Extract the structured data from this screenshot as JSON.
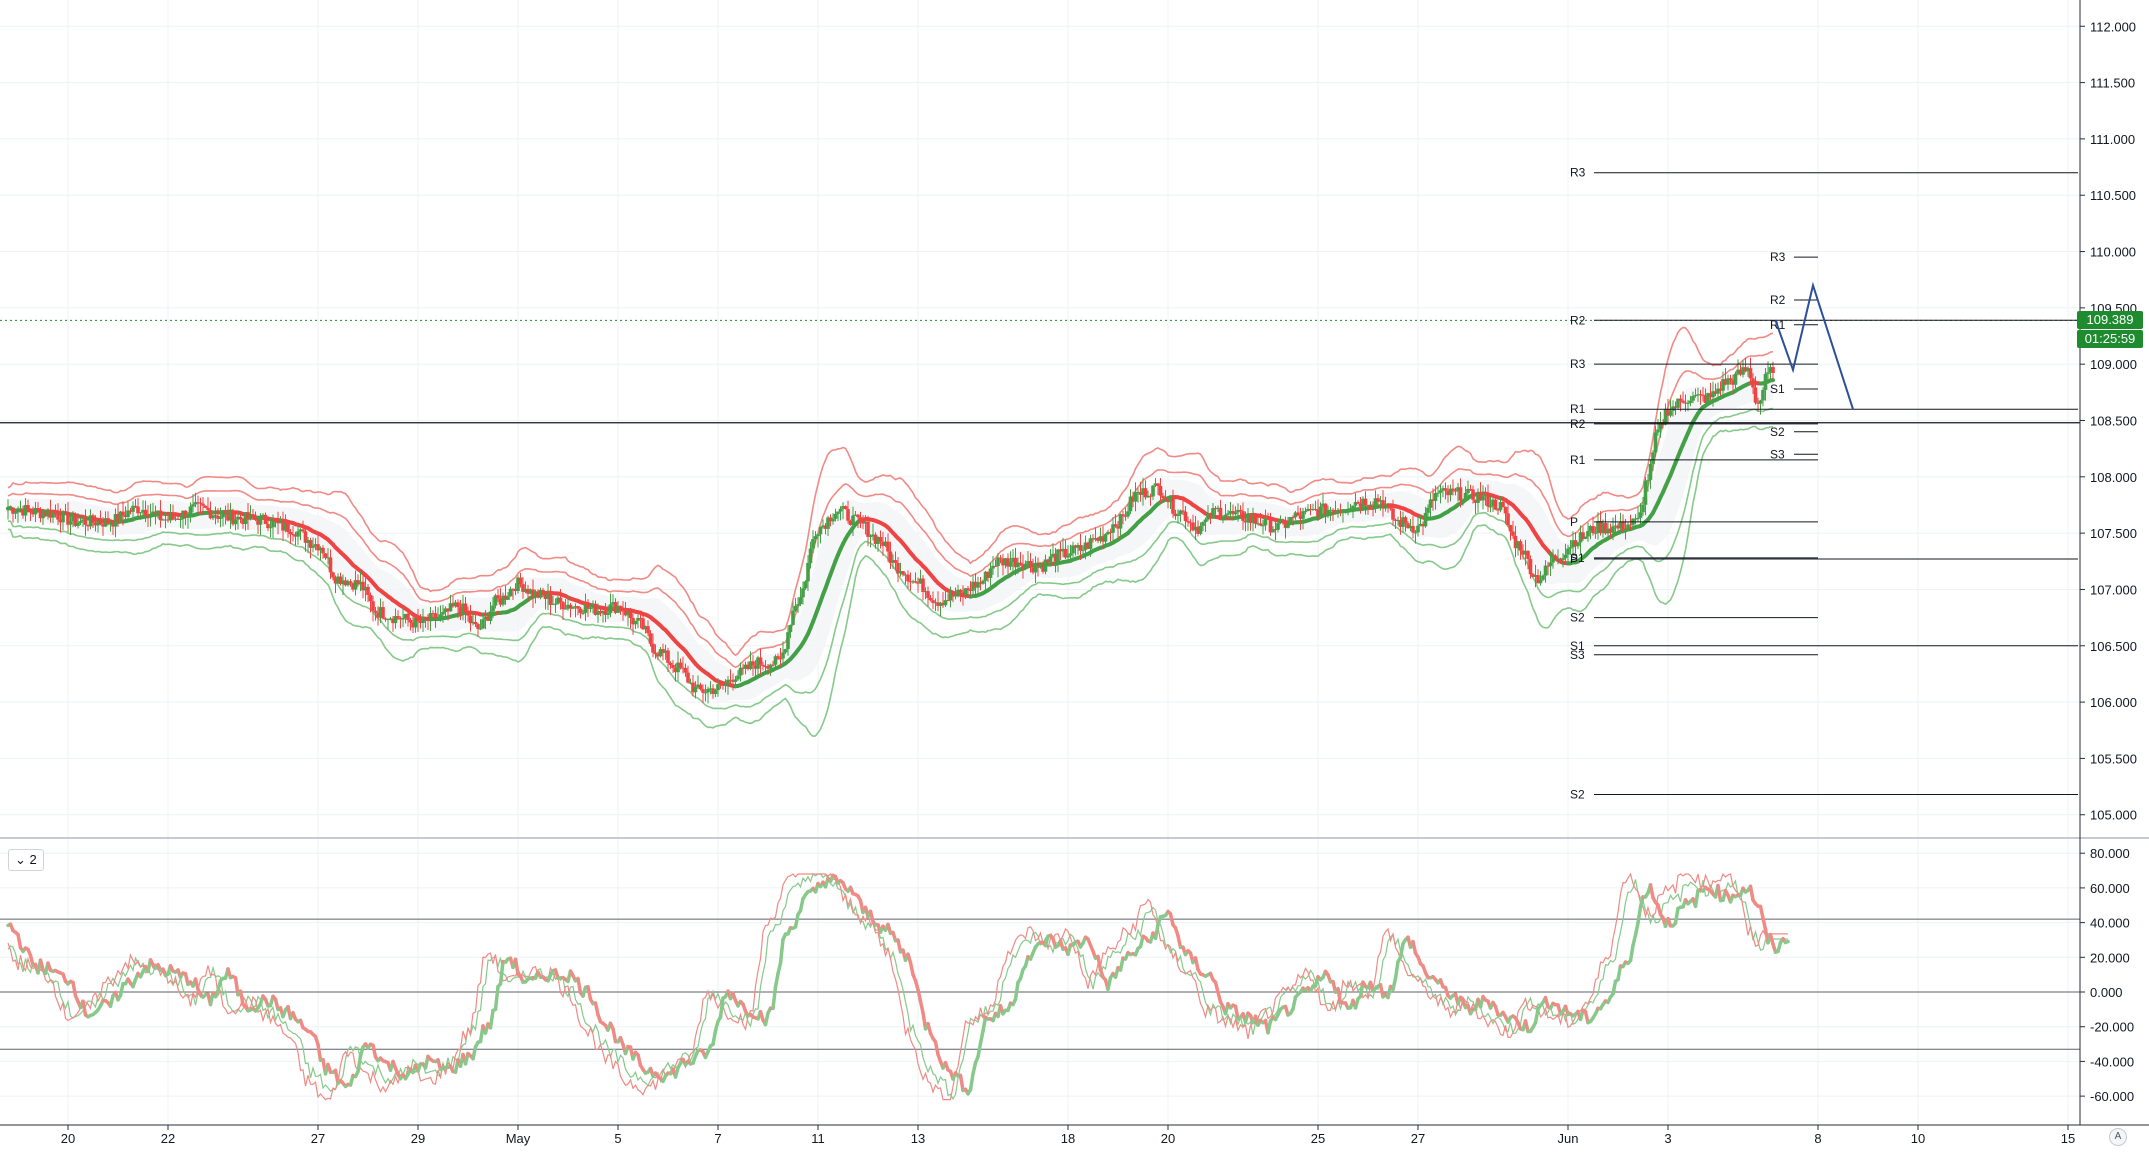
{
  "chart_data": [
    {
      "type": "candlestick",
      "pane": "price",
      "ylim": [
        104.9,
        112.1
      ],
      "yticks": [
        "112.000",
        "111.500",
        "111.000",
        "110.500",
        "110.000",
        "109.500",
        "109.000",
        "108.500",
        "108.000",
        "107.500",
        "107.000",
        "106.500",
        "106.000",
        "105.500",
        "105.000"
      ],
      "x_labels": [
        {
          "label": "20",
          "x": 12
        },
        {
          "label": "22",
          "x": 32
        },
        {
          "label": "27",
          "x": 62
        },
        {
          "label": "29",
          "x": 82
        },
        {
          "label": "May",
          "x": 102
        },
        {
          "label": "5",
          "x": 122
        },
        {
          "label": "7",
          "x": 142
        },
        {
          "label": "11",
          "x": 162
        },
        {
          "label": "13",
          "x": 182
        },
        {
          "label": "18",
          "x": 212
        },
        {
          "label": "20",
          "x": 232
        },
        {
          "label": "25",
          "x": 262
        },
        {
          "label": "27",
          "x": 282
        },
        {
          "label": "Jun",
          "x": 312
        },
        {
          "label": "3",
          "x": 332
        },
        {
          "label": "8",
          "x": 362
        },
        {
          "label": "10",
          "x": 382
        },
        {
          "label": "15",
          "x": 412
        }
      ],
      "x_last_candle": 353,
      "x_right_edge": 414,
      "anchors": [
        [
          0,
          107.72
        ],
        [
          8,
          107.68
        ],
        [
          14,
          107.6
        ],
        [
          20,
          107.6
        ],
        [
          26,
          107.72
        ],
        [
          32,
          107.62
        ],
        [
          38,
          107.72
        ],
        [
          44,
          107.64
        ],
        [
          50,
          107.62
        ],
        [
          56,
          107.55
        ],
        [
          62,
          107.4
        ],
        [
          66,
          107.1
        ],
        [
          70,
          107.05
        ],
        [
          74,
          106.8
        ],
        [
          78,
          106.75
        ],
        [
          82,
          106.7
        ],
        [
          86,
          106.75
        ],
        [
          90,
          106.85
        ],
        [
          94,
          106.65
        ],
        [
          98,
          106.9
        ],
        [
          102,
          107.05
        ],
        [
          106,
          106.95
        ],
        [
          110,
          106.88
        ],
        [
          114,
          106.85
        ],
        [
          118,
          106.82
        ],
        [
          122,
          106.85
        ],
        [
          126,
          106.7
        ],
        [
          130,
          106.45
        ],
        [
          134,
          106.3
        ],
        [
          138,
          106.1
        ],
        [
          142,
          106.12
        ],
        [
          146,
          106.25
        ],
        [
          150,
          106.35
        ],
        [
          154,
          106.35
        ],
        [
          158,
          106.9
        ],
        [
          162,
          107.55
        ],
        [
          166,
          107.7
        ],
        [
          170,
          107.6
        ],
        [
          174,
          107.45
        ],
        [
          178,
          107.2
        ],
        [
          182,
          107.05
        ],
        [
          186,
          106.9
        ],
        [
          190,
          106.95
        ],
        [
          194,
          107.05
        ],
        [
          198,
          107.25
        ],
        [
          202,
          107.25
        ],
        [
          206,
          107.2
        ],
        [
          210,
          107.3
        ],
        [
          214,
          107.35
        ],
        [
          218,
          107.45
        ],
        [
          222,
          107.6
        ],
        [
          226,
          107.85
        ],
        [
          230,
          107.9
        ],
        [
          234,
          107.7
        ],
        [
          238,
          107.55
        ],
        [
          242,
          107.7
        ],
        [
          246,
          107.65
        ],
        [
          250,
          107.6
        ],
        [
          254,
          107.55
        ],
        [
          258,
          107.65
        ],
        [
          262,
          107.7
        ],
        [
          266,
          107.72
        ],
        [
          270,
          107.78
        ],
        [
          274,
          107.8
        ],
        [
          278,
          107.6
        ],
        [
          282,
          107.55
        ],
        [
          286,
          107.85
        ],
        [
          290,
          107.85
        ],
        [
          294,
          107.82
        ],
        [
          298,
          107.75
        ],
        [
          302,
          107.4
        ],
        [
          306,
          107.1
        ],
        [
          310,
          107.3
        ],
        [
          314,
          107.45
        ],
        [
          318,
          107.55
        ],
        [
          322,
          107.55
        ],
        [
          326,
          107.6
        ],
        [
          328,
          108.0
        ],
        [
          330,
          108.4
        ],
        [
          332,
          108.6
        ],
        [
          336,
          108.7
        ],
        [
          340,
          108.7
        ],
        [
          344,
          108.85
        ],
        [
          348,
          108.95
        ],
        [
          350,
          108.65
        ],
        [
          352,
          108.9
        ],
        [
          355,
          109.2
        ],
        [
          356,
          109.39
        ]
      ],
      "series_names": [],
      "pivots": [
        {
          "label": "R3",
          "price": 110.7,
          "x_from": 312,
          "x_to": 414
        },
        {
          "label": "R2",
          "price": 109.39,
          "x_from": 312,
          "x_to": 414
        },
        {
          "label": "R3",
          "price": 109.0,
          "x_from": 312,
          "x_to": 362
        },
        {
          "label": "R1",
          "price": 108.6,
          "x_from": 312,
          "x_to": 414
        },
        {
          "label": "R2",
          "price": 108.47,
          "x_from": 312,
          "x_to": 362
        },
        {
          "label": "R1",
          "price": 108.15,
          "x_from": 312,
          "x_to": 362
        },
        {
          "label": "P",
          "price": 107.6,
          "x_from": 312,
          "x_to": 362
        },
        {
          "label": "P",
          "price": 107.27,
          "x_from": 312,
          "x_to": 414
        },
        {
          "label": "S1",
          "price": 107.28,
          "x_from": 312,
          "x_to": 362
        },
        {
          "label": "S2",
          "price": 106.75,
          "x_from": 312,
          "x_to": 362
        },
        {
          "label": "S1",
          "price": 106.5,
          "x_from": 312,
          "x_to": 414
        },
        {
          "label": "S3",
          "price": 106.42,
          "x_from": 312,
          "x_to": 362
        },
        {
          "label": "S2",
          "price": 105.18,
          "x_from": 312,
          "x_to": 414
        },
        {
          "label": "R3",
          "price": 109.95,
          "x_from": 352,
          "x_to": 362
        },
        {
          "label": "R2",
          "price": 109.57,
          "x_from": 352,
          "x_to": 362
        },
        {
          "label": "R1",
          "price": 109.35,
          "x_from": 352,
          "x_to": 362
        },
        {
          "label": "S1",
          "price": 108.78,
          "x_from": 352,
          "x_to": 362
        },
        {
          "label": "S2",
          "price": 108.4,
          "x_from": 352,
          "x_to": 362
        },
        {
          "label": "S3",
          "price": 108.2,
          "x_from": 352,
          "x_to": 362
        }
      ],
      "horizontal_line": 108.48,
      "projection": [
        [
          353.5,
          109.39
        ],
        [
          357,
          108.95
        ],
        [
          361,
          109.7
        ],
        [
          369,
          108.6
        ]
      ],
      "last_price": "109.389",
      "countdown": "01:25:59"
    },
    {
      "type": "line",
      "pane": "oscillator",
      "ylim": [
        -68,
        83
      ],
      "yticks": [
        "80.000",
        "60.000",
        "40.000",
        "20.000",
        "0.000",
        "-20.000",
        "-40.000",
        "-60.000"
      ],
      "levels": [
        42,
        0,
        -33
      ],
      "anchors": [
        [
          0,
          38
        ],
        [
          6,
          15
        ],
        [
          12,
          8
        ],
        [
          16,
          -12
        ],
        [
          20,
          -8
        ],
        [
          24,
          5
        ],
        [
          28,
          15
        ],
        [
          32,
          12
        ],
        [
          36,
          8
        ],
        [
          40,
          -5
        ],
        [
          44,
          10
        ],
        [
          48,
          -8
        ],
        [
          52,
          -5
        ],
        [
          56,
          -12
        ],
        [
          60,
          -22
        ],
        [
          64,
          -45
        ],
        [
          68,
          -55
        ],
        [
          72,
          -30
        ],
        [
          76,
          -42
        ],
        [
          80,
          -48
        ],
        [
          84,
          -40
        ],
        [
          88,
          -45
        ],
        [
          92,
          -38
        ],
        [
          96,
          -20
        ],
        [
          100,
          20
        ],
        [
          104,
          5
        ],
        [
          108,
          10
        ],
        [
          112,
          10
        ],
        [
          116,
          0
        ],
        [
          120,
          -20
        ],
        [
          124,
          -35
        ],
        [
          128,
          -45
        ],
        [
          132,
          -48
        ],
        [
          136,
          -40
        ],
        [
          140,
          -35
        ],
        [
          144,
          0
        ],
        [
          148,
          -10
        ],
        [
          152,
          -15
        ],
        [
          156,
          35
        ],
        [
          160,
          55
        ],
        [
          164,
          65
        ],
        [
          168,
          60
        ],
        [
          172,
          45
        ],
        [
          176,
          35
        ],
        [
          180,
          20
        ],
        [
          184,
          -20
        ],
        [
          188,
          -45
        ],
        [
          192,
          -55
        ],
        [
          196,
          -15
        ],
        [
          200,
          -10
        ],
        [
          204,
          20
        ],
        [
          208,
          30
        ],
        [
          212,
          25
        ],
        [
          216,
          30
        ],
        [
          220,
          5
        ],
        [
          224,
          20
        ],
        [
          228,
          30
        ],
        [
          232,
          45
        ],
        [
          236,
          20
        ],
        [
          240,
          10
        ],
        [
          244,
          -10
        ],
        [
          248,
          -15
        ],
        [
          252,
          -20
        ],
        [
          256,
          -10
        ],
        [
          260,
          0
        ],
        [
          264,
          10
        ],
        [
          268,
          -10
        ],
        [
          272,
          5
        ],
        [
          276,
          0
        ],
        [
          280,
          30
        ],
        [
          284,
          10
        ],
        [
          288,
          0
        ],
        [
          292,
          -10
        ],
        [
          296,
          -5
        ],
        [
          300,
          -15
        ],
        [
          304,
          -20
        ],
        [
          308,
          -5
        ],
        [
          312,
          -12
        ],
        [
          316,
          -15
        ],
        [
          320,
          -5
        ],
        [
          324,
          20
        ],
        [
          328,
          60
        ],
        [
          332,
          40
        ],
        [
          336,
          50
        ],
        [
          340,
          60
        ],
        [
          344,
          55
        ],
        [
          348,
          60
        ],
        [
          350,
          50
        ],
        [
          352,
          30
        ],
        [
          354,
          25
        ],
        [
          356,
          32
        ]
      ],
      "fast_offset": 8,
      "slow_offset": 6,
      "indicator_badge": "2"
    }
  ],
  "colors": {
    "up": "#43a047",
    "down": "#ef4444",
    "grid": "#eef2f6",
    "axis_text": "#131722",
    "band_upper": "#f08a85",
    "band_lower": "#86c98a",
    "projection": "#2b4f9a",
    "last_price_bg": "#1e8c2e"
  },
  "ui": {
    "pane_toggle": "2",
    "corner_label": "A"
  }
}
